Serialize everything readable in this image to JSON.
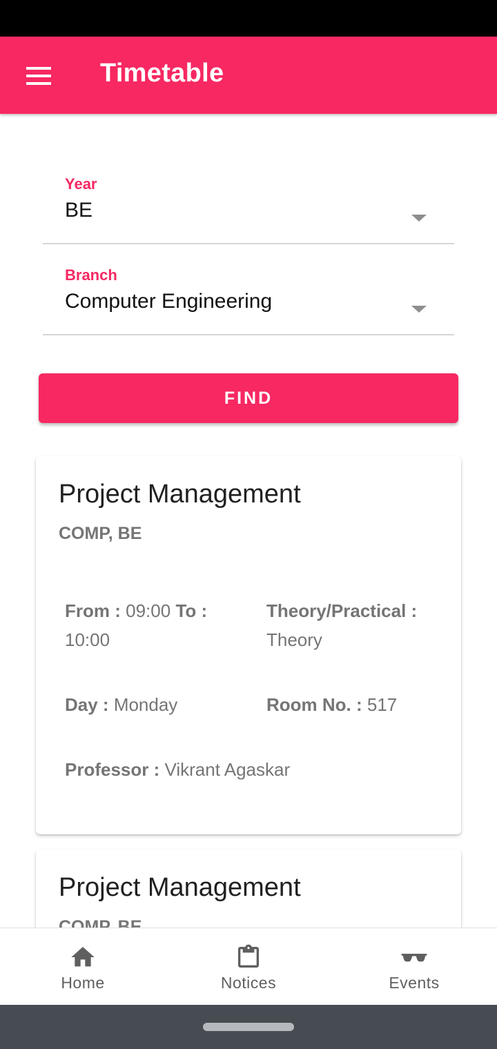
{
  "app_bar": {
    "title": "Timetable",
    "menu_icon": "menu-icon"
  },
  "form": {
    "year": {
      "label": "Year",
      "value": "BE"
    },
    "branch": {
      "label": "Branch",
      "value": "Computer Engineering"
    },
    "find_label": "FIND"
  },
  "cards": [
    {
      "title": "Project Management",
      "subtitle": "COMP, BE",
      "from_label": "From :",
      "from_value": "09:00",
      "to_label": "To :",
      "to_value": "10:00",
      "type_label": "Theory/Practical :",
      "type_value": "Theory",
      "day_label": "Day :",
      "day_value": "Monday",
      "room_label": "Room No. :",
      "room_value": "517",
      "professor_label": "Professor :",
      "professor_value": "Vikrant Agaskar"
    },
    {
      "title": "Project Management",
      "subtitle": "COMP, BE"
    }
  ],
  "bottom_nav": {
    "items": [
      {
        "label": "Home",
        "icon": "home-icon"
      },
      {
        "label": "Notices",
        "icon": "clipboard-icon"
      },
      {
        "label": "Events",
        "icon": "sunglasses-icon"
      }
    ]
  },
  "colors": {
    "accent": "#f72862",
    "status_bar": "#000000",
    "system_nav": "#474c53"
  }
}
